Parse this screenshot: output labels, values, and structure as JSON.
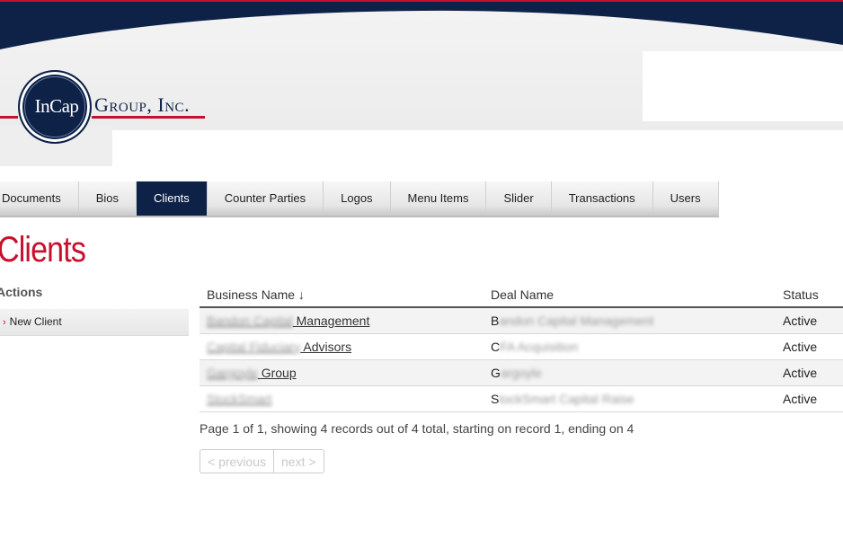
{
  "brand": {
    "emblem_text": "InCap",
    "company_text": "Group, Inc.",
    "navy": "#0e2248",
    "red": "#c8102e"
  },
  "nav": {
    "items": [
      {
        "label": "Documents",
        "active": false
      },
      {
        "label": "Bios",
        "active": false
      },
      {
        "label": "Clients",
        "active": true
      },
      {
        "label": "Counter Parties",
        "active": false
      },
      {
        "label": "Logos",
        "active": false
      },
      {
        "label": "Menu Items",
        "active": false
      },
      {
        "label": "Slider",
        "active": false
      },
      {
        "label": "Transactions",
        "active": false
      },
      {
        "label": "Users",
        "active": false
      }
    ]
  },
  "page": {
    "title": "Clients"
  },
  "sidebar": {
    "heading": "Actions",
    "new_client": "New Client",
    "arrow_icon": "chevron-right-icon"
  },
  "table": {
    "headers": {
      "business_name": "Business Name ↓",
      "deal_name": "Deal Name",
      "status": "Status"
    },
    "rows": [
      {
        "biz_blurred": "Bandon Capital",
        "biz_visible": " Management",
        "deal_first": "B",
        "deal_blurred": "andon Capital Management",
        "status": "Active"
      },
      {
        "biz_blurred": "Capital Fiduciary",
        "biz_visible": " Advisors",
        "deal_first": "C",
        "deal_blurred": "FA Acquisition",
        "status": "Active"
      },
      {
        "biz_blurred": "Gargoyle",
        "biz_visible": " Group",
        "deal_first": "G",
        "deal_blurred": "argoyle",
        "status": "Active"
      },
      {
        "biz_blurred": "StockSmart",
        "biz_visible": "",
        "deal_first": "S",
        "deal_blurred": "tockSmart Capital Raise",
        "status": "Active"
      }
    ]
  },
  "paging": {
    "summary": "Page 1 of 1, showing 4 records out of 4 total, starting on record 1, ending on 4",
    "previous": "< previous",
    "next": "next >"
  }
}
